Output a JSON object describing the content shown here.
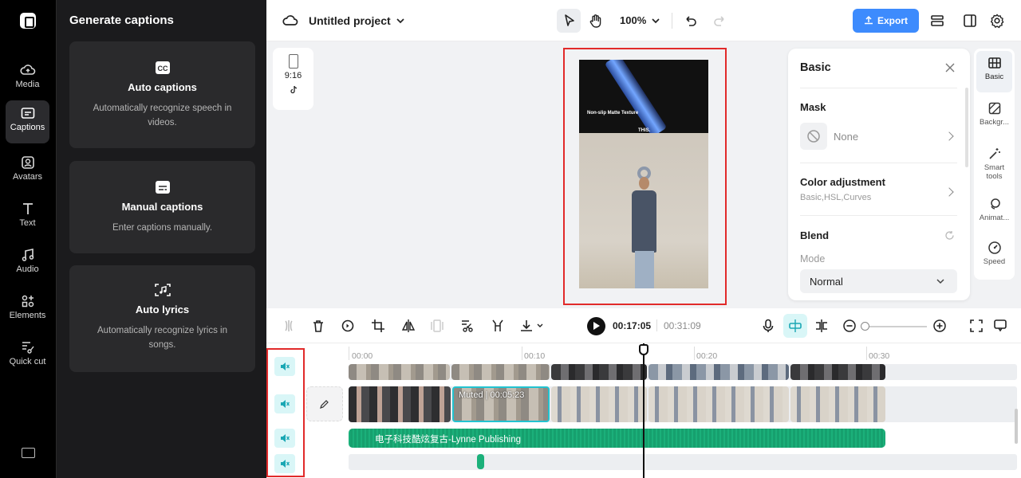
{
  "nav": {
    "items": [
      {
        "label": "Media",
        "icon": "cloud-media-icon"
      },
      {
        "label": "Captions",
        "icon": "captions-icon",
        "active": true
      },
      {
        "label": "Avatars",
        "icon": "avatar-icon"
      },
      {
        "label": "Text",
        "icon": "text-icon"
      },
      {
        "label": "Audio",
        "icon": "music-note-icon"
      },
      {
        "label": "Elements",
        "icon": "elements-icon"
      },
      {
        "label": "Quick cut",
        "icon": "quick-cut-icon"
      }
    ]
  },
  "panel": {
    "title": "Generate captions",
    "cards": [
      {
        "title": "Auto captions",
        "desc": "Automatically recognize speech in videos.",
        "icon": "cc-icon"
      },
      {
        "title": "Manual captions",
        "desc": "Enter captions manually.",
        "icon": "subtitle-icon"
      },
      {
        "title": "Auto lyrics",
        "desc": "Automatically recognize lyrics in songs.",
        "icon": "lyrics-scan-icon"
      }
    ]
  },
  "topbar": {
    "project_title": "Untitled project",
    "zoom": "100%",
    "export_label": "Export",
    "accent": "#3d8bfd"
  },
  "canvas": {
    "ratio_label": "9:16",
    "video_text_1": "Non-slip Matte Texture",
    "video_text_2": "THIS."
  },
  "props": {
    "title": "Basic",
    "mask_title": "Mask",
    "mask_value": "None",
    "color_title": "Color adjustment",
    "color_sub": "Basic,HSL,Curves",
    "blend_title": "Blend",
    "mode_label": "Mode",
    "mode_value": "Normal"
  },
  "rail": {
    "items": [
      {
        "label": "Basic",
        "active": true
      },
      {
        "label": "Backgr..."
      },
      {
        "label": "Smart tools"
      },
      {
        "label": "Animat..."
      },
      {
        "label": "Speed"
      }
    ]
  },
  "timeline": {
    "current_time": "00:17:05",
    "total_time": "00:31:09",
    "ruler": [
      "00:00",
      "00:10",
      "00:20",
      "00:30"
    ],
    "selected_clip_label": "Muted | 00:05:23",
    "audio_track_label": "电子科技酷炫复古-Lynne Publishing",
    "highlight_color": "#e12a2a"
  }
}
